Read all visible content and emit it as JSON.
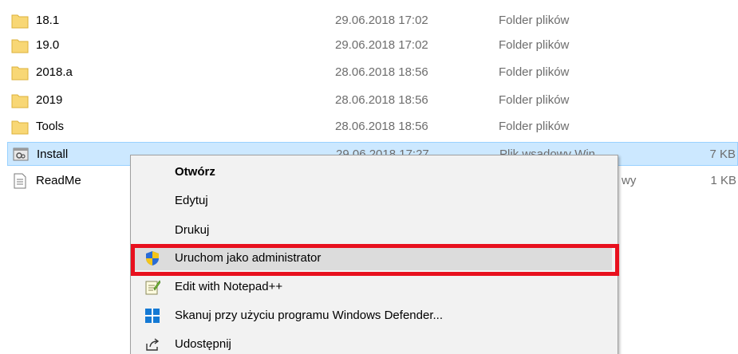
{
  "files": [
    {
      "name": "18.1",
      "date": "29.06.2018 17:02",
      "type": "Folder plików",
      "size": "",
      "icon": "folder-icon"
    },
    {
      "name": "19.0",
      "date": "29.06.2018 17:02",
      "type": "Folder plików",
      "size": "",
      "icon": "folder-icon"
    },
    {
      "name": "2018.a",
      "date": "28.06.2018 18:56",
      "type": "Folder plików",
      "size": "",
      "icon": "folder-icon"
    },
    {
      "name": "2019",
      "date": "28.06.2018 18:56",
      "type": "Folder plików",
      "size": "",
      "icon": "folder-icon"
    },
    {
      "name": "Tools",
      "date": "28.06.2018 18:56",
      "type": "Folder plików",
      "size": "",
      "icon": "folder-icon"
    },
    {
      "name": "Install",
      "date": "29.06.2018 17:27",
      "type": "Plik wsadowy Win...",
      "size": "7 KB",
      "icon": "batch-file-icon"
    },
    {
      "name": "ReadMe",
      "date": "",
      "type": "wy",
      "size": "1 KB",
      "icon": "text-file-icon"
    }
  ],
  "context_menu": {
    "items": [
      {
        "label": "Otwórz",
        "icon": "",
        "bold": true
      },
      {
        "label": "Edytuj",
        "icon": ""
      },
      {
        "label": "Drukuj",
        "icon": ""
      },
      {
        "label": "Uruchom jako administrator",
        "icon": "uac-shield-icon"
      },
      {
        "label": "Edit with Notepad++",
        "icon": "notepad-plus-plus-icon"
      },
      {
        "label": "Skanuj przy użyciu programu Windows Defender...",
        "icon": "windows-defender-icon"
      },
      {
        "label": "Udostępnij",
        "icon": "share-icon"
      }
    ]
  },
  "colors": {
    "selection_bg": "#cce8ff",
    "selection_border": "#99d1ff",
    "highlight": "#e8101e",
    "folder": "#f8d775"
  }
}
